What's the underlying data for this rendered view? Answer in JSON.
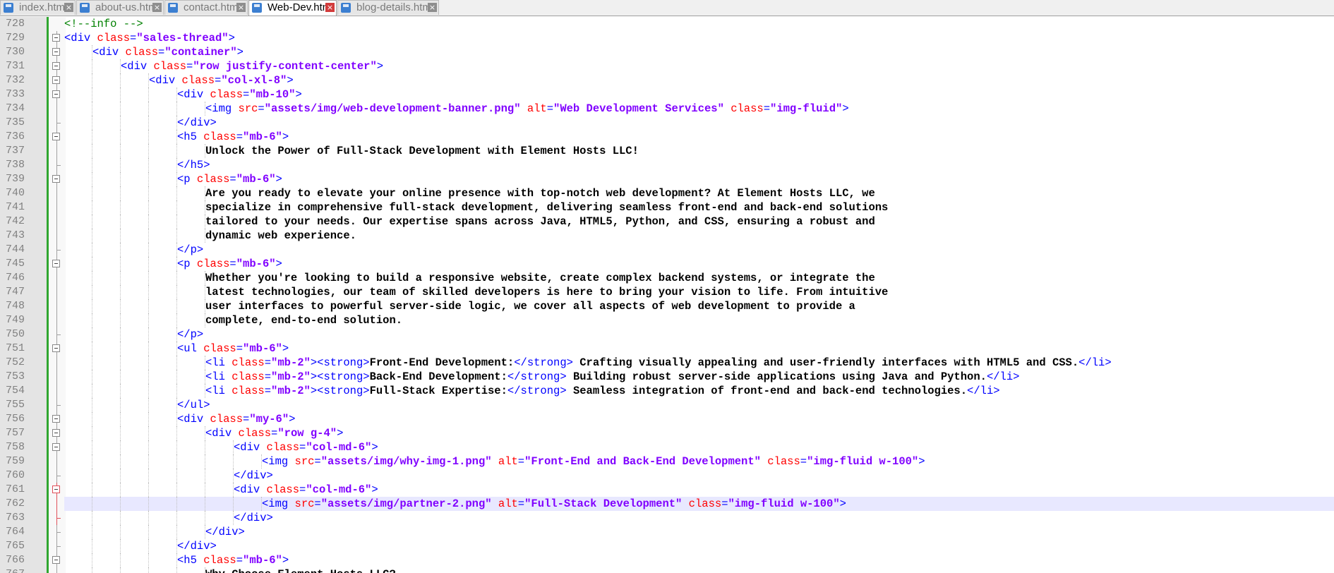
{
  "tabs": [
    {
      "label": "index.html",
      "active": false
    },
    {
      "label": "about-us.html",
      "active": false
    },
    {
      "label": "contact.html",
      "active": false
    },
    {
      "label": "Web-Dev.html",
      "active": true
    },
    {
      "label": "blog-details.html",
      "active": false
    }
  ],
  "icons": {
    "file": "file-icon",
    "close": "close-icon",
    "fold": "fold-toggle-icon"
  },
  "colors": {
    "tag": "#0000ff",
    "attribute": "#ff0000",
    "value": "#8000ff",
    "text": "#000000",
    "comment": "#008000",
    "current_line": "#e8e8ff",
    "change_bar": "#2fa62f"
  },
  "editor": {
    "current_line": 762,
    "lines": [
      {
        "n": 728,
        "indent": 0,
        "fold": "none",
        "segs": [
          [
            "c",
            "<!--info -->"
          ]
        ]
      },
      {
        "n": 729,
        "indent": 0,
        "fold": "open",
        "segs": [
          [
            "t",
            "<div "
          ],
          [
            "a",
            "class"
          ],
          [
            "t",
            "="
          ],
          [
            "v",
            "\"sales-thread\""
          ],
          [
            "t",
            ">"
          ]
        ]
      },
      {
        "n": 730,
        "indent": 1,
        "fold": "open",
        "segs": [
          [
            "t",
            "<div "
          ],
          [
            "a",
            "class"
          ],
          [
            "t",
            "="
          ],
          [
            "v",
            "\"container\""
          ],
          [
            "t",
            ">"
          ]
        ]
      },
      {
        "n": 731,
        "indent": 2,
        "fold": "open",
        "segs": [
          [
            "t",
            "<div "
          ],
          [
            "a",
            "class"
          ],
          [
            "t",
            "="
          ],
          [
            "v",
            "\"row justify-content-center\""
          ],
          [
            "t",
            ">"
          ]
        ]
      },
      {
        "n": 732,
        "indent": 3,
        "fold": "open",
        "segs": [
          [
            "t",
            "<div "
          ],
          [
            "a",
            "class"
          ],
          [
            "t",
            "="
          ],
          [
            "v",
            "\"col-xl-8\""
          ],
          [
            "t",
            ">"
          ]
        ]
      },
      {
        "n": 733,
        "indent": 4,
        "fold": "open",
        "segs": [
          [
            "t",
            "<div "
          ],
          [
            "a",
            "class"
          ],
          [
            "t",
            "="
          ],
          [
            "v",
            "\"mb-10\""
          ],
          [
            "t",
            ">"
          ]
        ]
      },
      {
        "n": 734,
        "indent": 5,
        "fold": "none",
        "segs": [
          [
            "t",
            "<img "
          ],
          [
            "a",
            "src"
          ],
          [
            "t",
            "="
          ],
          [
            "v",
            "\"assets/img/web-development-banner.png\""
          ],
          [
            "t",
            " "
          ],
          [
            "a",
            "alt"
          ],
          [
            "t",
            "="
          ],
          [
            "v",
            "\"Web Development Services\""
          ],
          [
            "t",
            " "
          ],
          [
            "a",
            "class"
          ],
          [
            "t",
            "="
          ],
          [
            "v",
            "\"img-fluid\""
          ],
          [
            "t",
            ">"
          ]
        ]
      },
      {
        "n": 735,
        "indent": 4,
        "fold": "end",
        "segs": [
          [
            "t",
            "</div>"
          ]
        ]
      },
      {
        "n": 736,
        "indent": 4,
        "fold": "open",
        "segs": [
          [
            "t",
            "<h5 "
          ],
          [
            "a",
            "class"
          ],
          [
            "t",
            "="
          ],
          [
            "v",
            "\"mb-6\""
          ],
          [
            "t",
            ">"
          ]
        ]
      },
      {
        "n": 737,
        "indent": 5,
        "fold": "none",
        "segs": [
          [
            "x",
            "Unlock the Power of Full-Stack Development with Element Hosts LLC!"
          ]
        ]
      },
      {
        "n": 738,
        "indent": 4,
        "fold": "end",
        "segs": [
          [
            "t",
            "</h5>"
          ]
        ]
      },
      {
        "n": 739,
        "indent": 4,
        "fold": "open",
        "segs": [
          [
            "t",
            "<p "
          ],
          [
            "a",
            "class"
          ],
          [
            "t",
            "="
          ],
          [
            "v",
            "\"mb-6\""
          ],
          [
            "t",
            ">"
          ]
        ]
      },
      {
        "n": 740,
        "indent": 5,
        "fold": "none",
        "segs": [
          [
            "x",
            "Are you ready to elevate your online presence with top-notch web development? At Element Hosts LLC, we"
          ]
        ]
      },
      {
        "n": 741,
        "indent": 5,
        "fold": "none",
        "segs": [
          [
            "x",
            "specialize in comprehensive full-stack development, delivering seamless front-end and back-end solutions"
          ]
        ]
      },
      {
        "n": 742,
        "indent": 5,
        "fold": "none",
        "segs": [
          [
            "x",
            "tailored to your needs. Our expertise spans across Java, HTML5, Python, and CSS, ensuring a robust and"
          ]
        ]
      },
      {
        "n": 743,
        "indent": 5,
        "fold": "none",
        "segs": [
          [
            "x",
            "dynamic web experience."
          ]
        ]
      },
      {
        "n": 744,
        "indent": 4,
        "fold": "end",
        "segs": [
          [
            "t",
            "</p>"
          ]
        ]
      },
      {
        "n": 745,
        "indent": 4,
        "fold": "open",
        "segs": [
          [
            "t",
            "<p "
          ],
          [
            "a",
            "class"
          ],
          [
            "t",
            "="
          ],
          [
            "v",
            "\"mb-6\""
          ],
          [
            "t",
            ">"
          ]
        ]
      },
      {
        "n": 746,
        "indent": 5,
        "fold": "none",
        "segs": [
          [
            "x",
            "Whether you're looking to build a responsive website, create complex backend systems, or integrate the"
          ]
        ]
      },
      {
        "n": 747,
        "indent": 5,
        "fold": "none",
        "segs": [
          [
            "x",
            "latest technologies, our team of skilled developers is here to bring your vision to life. From intuitive"
          ]
        ]
      },
      {
        "n": 748,
        "indent": 5,
        "fold": "none",
        "segs": [
          [
            "x",
            "user interfaces to powerful server-side logic, we cover all aspects of web development to provide a"
          ]
        ]
      },
      {
        "n": 749,
        "indent": 5,
        "fold": "none",
        "segs": [
          [
            "x",
            "complete, end-to-end solution."
          ]
        ]
      },
      {
        "n": 750,
        "indent": 4,
        "fold": "end",
        "segs": [
          [
            "t",
            "</p>"
          ]
        ]
      },
      {
        "n": 751,
        "indent": 4,
        "fold": "open",
        "segs": [
          [
            "t",
            "<ul "
          ],
          [
            "a",
            "class"
          ],
          [
            "t",
            "="
          ],
          [
            "v",
            "\"mb-6\""
          ],
          [
            "t",
            ">"
          ]
        ]
      },
      {
        "n": 752,
        "indent": 5,
        "fold": "none",
        "segs": [
          [
            "t",
            "<li "
          ],
          [
            "a",
            "class"
          ],
          [
            "t",
            "="
          ],
          [
            "v",
            "\"mb-2\""
          ],
          [
            "t",
            "><strong>"
          ],
          [
            "x",
            "Front-End Development:"
          ],
          [
            "t",
            "</strong>"
          ],
          [
            "x",
            " Crafting visually appealing and user-friendly interfaces with HTML5 and CSS."
          ],
          [
            "t",
            "</li>"
          ]
        ]
      },
      {
        "n": 753,
        "indent": 5,
        "fold": "none",
        "segs": [
          [
            "t",
            "<li "
          ],
          [
            "a",
            "class"
          ],
          [
            "t",
            "="
          ],
          [
            "v",
            "\"mb-2\""
          ],
          [
            "t",
            "><strong>"
          ],
          [
            "x",
            "Back-End Development:"
          ],
          [
            "t",
            "</strong>"
          ],
          [
            "x",
            " Building robust server-side applications using Java and Python."
          ],
          [
            "t",
            "</li>"
          ]
        ]
      },
      {
        "n": 754,
        "indent": 5,
        "fold": "none",
        "segs": [
          [
            "t",
            "<li "
          ],
          [
            "a",
            "class"
          ],
          [
            "t",
            "="
          ],
          [
            "v",
            "\"mb-2\""
          ],
          [
            "t",
            "><strong>"
          ],
          [
            "x",
            "Full-Stack Expertise:"
          ],
          [
            "t",
            "</strong>"
          ],
          [
            "x",
            " Seamless integration of front-end and back-end technologies."
          ],
          [
            "t",
            "</li>"
          ]
        ]
      },
      {
        "n": 755,
        "indent": 4,
        "fold": "end",
        "segs": [
          [
            "t",
            "</ul>"
          ]
        ]
      },
      {
        "n": 756,
        "indent": 4,
        "fold": "open",
        "segs": [
          [
            "t",
            "<div "
          ],
          [
            "a",
            "class"
          ],
          [
            "t",
            "="
          ],
          [
            "v",
            "\"my-6\""
          ],
          [
            "t",
            ">"
          ]
        ]
      },
      {
        "n": 757,
        "indent": 5,
        "fold": "open",
        "segs": [
          [
            "t",
            "<div "
          ],
          [
            "a",
            "class"
          ],
          [
            "t",
            "="
          ],
          [
            "v",
            "\"row g-4\""
          ],
          [
            "t",
            ">"
          ]
        ]
      },
      {
        "n": 758,
        "indent": 6,
        "fold": "open",
        "segs": [
          [
            "t",
            "<div "
          ],
          [
            "a",
            "class"
          ],
          [
            "t",
            "="
          ],
          [
            "v",
            "\"col-md-6\""
          ],
          [
            "t",
            ">"
          ]
        ]
      },
      {
        "n": 759,
        "indent": 7,
        "fold": "none",
        "segs": [
          [
            "t",
            "<img "
          ],
          [
            "a",
            "src"
          ],
          [
            "t",
            "="
          ],
          [
            "v",
            "\"assets/img/why-img-1.png\""
          ],
          [
            "t",
            " "
          ],
          [
            "a",
            "alt"
          ],
          [
            "t",
            "="
          ],
          [
            "v",
            "\"Front-End and Back-End Development\""
          ],
          [
            "t",
            " "
          ],
          [
            "a",
            "class"
          ],
          [
            "t",
            "="
          ],
          [
            "v",
            "\"img-fluid w-100\""
          ],
          [
            "t",
            ">"
          ]
        ]
      },
      {
        "n": 760,
        "indent": 6,
        "fold": "end",
        "segs": [
          [
            "t",
            "</div>"
          ]
        ]
      },
      {
        "n": 761,
        "indent": 6,
        "fold": "open-red",
        "segs": [
          [
            "t",
            "<div "
          ],
          [
            "a",
            "class"
          ],
          [
            "t",
            "="
          ],
          [
            "v",
            "\"col-md-6\""
          ],
          [
            "t",
            ">"
          ]
        ]
      },
      {
        "n": 762,
        "indent": 7,
        "fold": "none-red",
        "segs": [
          [
            "t",
            "<img "
          ],
          [
            "a",
            "src"
          ],
          [
            "t",
            "="
          ],
          [
            "v",
            "\"assets/img/partner-2.png\""
          ],
          [
            "t",
            " "
          ],
          [
            "a",
            "alt"
          ],
          [
            "t",
            "="
          ],
          [
            "v",
            "\"Full-Stack Development\""
          ],
          [
            "t",
            " "
          ],
          [
            "a",
            "class"
          ],
          [
            "t",
            "="
          ],
          [
            "v",
            "\"img-fluid w-100\""
          ],
          [
            "t",
            ">"
          ]
        ]
      },
      {
        "n": 763,
        "indent": 6,
        "fold": "end-red",
        "segs": [
          [
            "t",
            "</div>"
          ]
        ]
      },
      {
        "n": 764,
        "indent": 5,
        "fold": "end",
        "segs": [
          [
            "t",
            "</div>"
          ]
        ]
      },
      {
        "n": 765,
        "indent": 4,
        "fold": "end",
        "segs": [
          [
            "t",
            "</div>"
          ]
        ]
      },
      {
        "n": 766,
        "indent": 4,
        "fold": "open",
        "segs": [
          [
            "t",
            "<h5 "
          ],
          [
            "a",
            "class"
          ],
          [
            "t",
            "="
          ],
          [
            "v",
            "\"mb-6\""
          ],
          [
            "t",
            ">"
          ]
        ]
      },
      {
        "n": 767,
        "indent": 5,
        "fold": "none",
        "segs": [
          [
            "x",
            "Why Choose Element Hosts LLC?"
          ]
        ]
      }
    ]
  }
}
